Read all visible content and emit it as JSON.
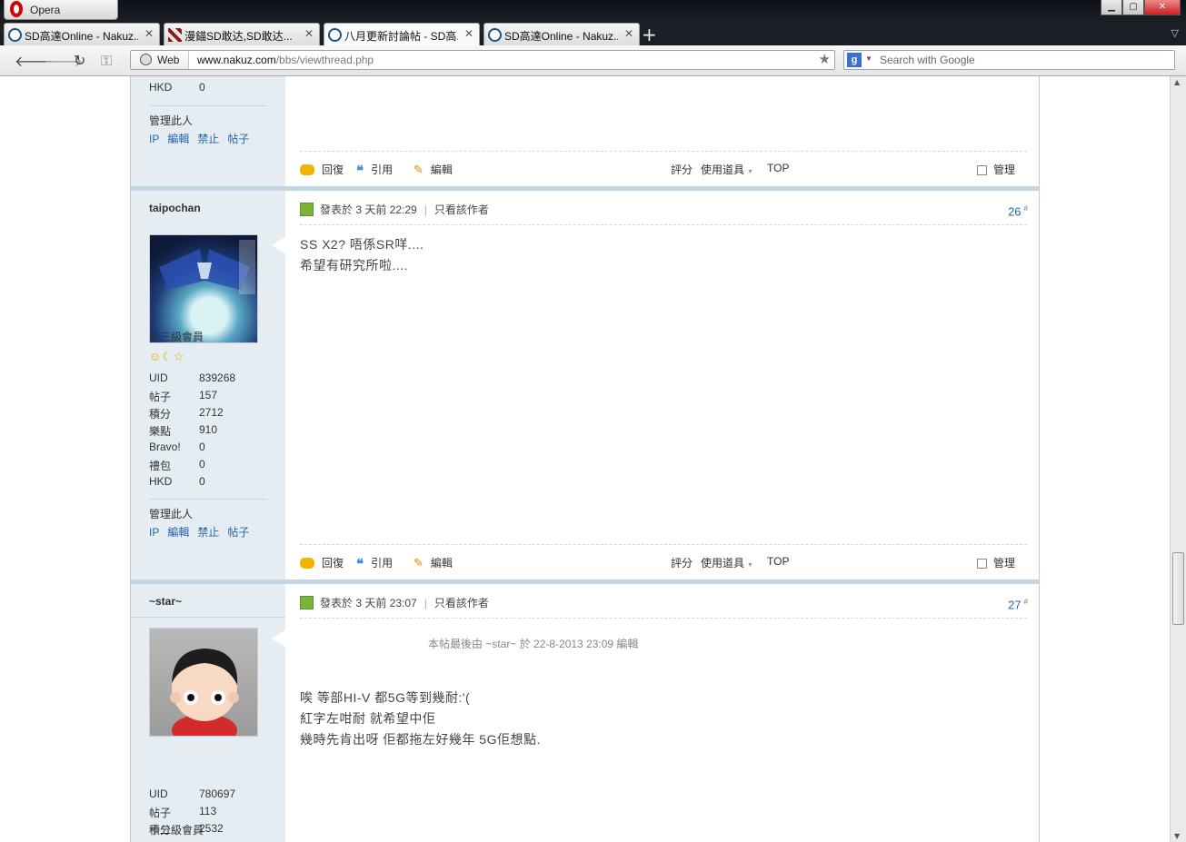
{
  "browser": {
    "menu_label": "Opera",
    "tabs": [
      {
        "title": "SD高達Online - Nakuz..."
      },
      {
        "title": "漫錨SD敢达,SD敢达..."
      },
      {
        "title": "八月更新討論帖 - SD高..."
      },
      {
        "title": "SD高達Online - Nakuz..."
      }
    ],
    "new_tab": "+",
    "address_badge": "Web",
    "url_domain": "www.nakuz.com",
    "url_path": "/bbs/viewthread.php",
    "search_engine_icon": "g",
    "search_placeholder": "Search with Google"
  },
  "post0_tail": {
    "stat_hkd_label": "HKD",
    "stat_hkd_value": "0",
    "manage": "管理此人",
    "links": [
      "IP",
      "編輯",
      "禁止",
      "帖子"
    ],
    "actions": {
      "reply": "回復",
      "quote": "引用",
      "edit": "編輯",
      "rate": "評分",
      "tools": "使用道具",
      "top": "TOP",
      "manage": "管理"
    }
  },
  "posts": [
    {
      "username": "taipochan",
      "rank": "十三級會員",
      "stars": "☺☾☆",
      "stats": [
        {
          "k": "UID",
          "v": "839268"
        },
        {
          "k": "帖子",
          "v": "157"
        },
        {
          "k": "積分",
          "v": "2712"
        },
        {
          "k": "樂點",
          "v": "910"
        },
        {
          "k": "Bravo!",
          "v": "0"
        },
        {
          "k": "禮包",
          "v": "0"
        },
        {
          "k": "HKD",
          "v": "0"
        }
      ],
      "manage": "管理此人",
      "links": [
        "IP",
        "編輯",
        "禁止",
        "帖子"
      ],
      "posted_label": "發表於",
      "posted_time": "3 天前 22:29",
      "only_author": "只看該作者",
      "floor": "26",
      "floor_mark": "#",
      "lines": [
        "SS X2? 唔係SR咩....",
        "希望有研究所啦...."
      ],
      "actions": {
        "reply": "回復",
        "quote": "引用",
        "edit": "編輯",
        "rate": "評分",
        "tools": "使用道具",
        "top": "TOP",
        "manage": "管理"
      }
    },
    {
      "username": "~star~",
      "rank": "十二級會員",
      "stars": "☺☾",
      "stats": [
        {
          "k": "UID",
          "v": "780697"
        },
        {
          "k": "帖子",
          "v": "113"
        },
        {
          "k": "積分",
          "v": "2532"
        }
      ],
      "posted_label": "發表於",
      "posted_time": "3 天前 23:07",
      "only_author": "只看該作者",
      "floor": "27",
      "floor_mark": "#",
      "edited_note": "本帖最後由 ~star~ 於 22-8-2013 23:09 編輯",
      "lines": [
        "唉 等部HI-V 都5G等到幾耐:'(",
        "紅字左咁耐 就希望中佢",
        "幾時先肯出呀 佢都拖左好幾年 5G佢想點."
      ]
    }
  ],
  "colors": {
    "sidebar": "#e5edf2",
    "separator": "#c2d5e3",
    "link": "#2366a8"
  }
}
